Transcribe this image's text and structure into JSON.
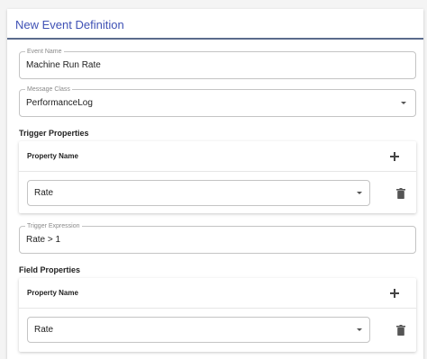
{
  "dialog": {
    "title": "New Event Definition"
  },
  "event_name": {
    "label": "Event Name",
    "value": "Machine Run Rate"
  },
  "message_class": {
    "label": "Message Class",
    "value": "PerformanceLog"
  },
  "trigger_properties": {
    "title": "Trigger Properties",
    "column_header": "Property Name",
    "rows": [
      {
        "value": "Rate"
      }
    ]
  },
  "trigger_expression": {
    "label": "Trigger Expression",
    "value": "Rate > 1"
  },
  "field_properties": {
    "title": "Field Properties",
    "column_header": "Property Name",
    "rows": [
      {
        "value": "Rate"
      }
    ]
  },
  "icons": {
    "add": "plus-icon",
    "delete": "trash-icon",
    "dropdown": "caret-down-icon"
  },
  "colors": {
    "title_accent": "#3f51b5",
    "header_underline": "#5b6b8c"
  }
}
